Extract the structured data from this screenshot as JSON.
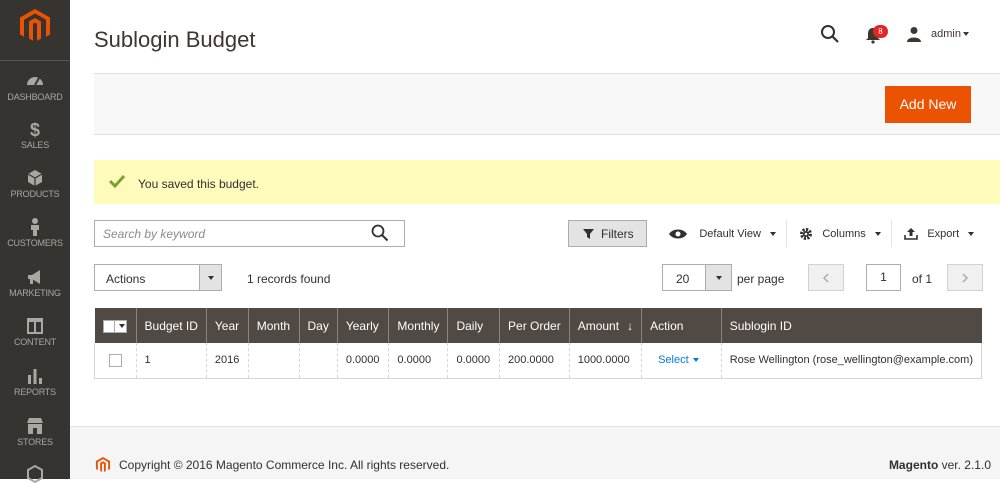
{
  "header": {
    "page_title": "Sublogin Budget",
    "notification_count": "8",
    "user_name": "admin"
  },
  "sidebar": {
    "items": [
      {
        "label": "Dashboard",
        "icon": "dashboard-icon"
      },
      {
        "label": "Sales",
        "icon": "dollar-icon"
      },
      {
        "label": "Products",
        "icon": "box-icon"
      },
      {
        "label": "Customers",
        "icon": "person-icon"
      },
      {
        "label": "Marketing",
        "icon": "megaphone-icon"
      },
      {
        "label": "Content",
        "icon": "layout-icon"
      },
      {
        "label": "Reports",
        "icon": "bar-chart-icon"
      },
      {
        "label": "Stores",
        "icon": "store-icon"
      }
    ]
  },
  "actions": {
    "add_new": "Add New"
  },
  "message": {
    "text": "You saved this budget."
  },
  "toolbar": {
    "search_placeholder": "Search by keyword",
    "filters": "Filters",
    "default_view": "Default View",
    "columns": "Columns",
    "export": "Export",
    "mass_actions": "Actions",
    "records_found": "1 records found",
    "per_page_value": "20",
    "per_page_label": "per page",
    "current_page": "1",
    "total_pages": "of 1"
  },
  "grid": {
    "columns": [
      "Budget ID",
      "Year",
      "Month",
      "Day",
      "Yearly",
      "Monthly",
      "Daily",
      "Per Order",
      "Amount",
      "Action",
      "Sublogin ID"
    ],
    "sort_indicator": "↓",
    "rows": [
      {
        "budget_id": "1",
        "year": "2016",
        "month": "",
        "day": "",
        "yearly": "0.0000",
        "monthly": "0.0000",
        "daily": "0.0000",
        "per_order": "200.0000",
        "amount": "1000.0000",
        "action": "Select",
        "sublogin_id": "Rose Wellington (rose_wellington@example.com)"
      }
    ]
  },
  "footer": {
    "copyright": "Copyright © 2016 Magento Commerce Inc. All rights reserved.",
    "brand": "Magento",
    "version": "ver. 2.1.0"
  },
  "colors": {
    "sidebar_bg": "#373330",
    "accent_orange": "#eb5202",
    "grid_header_bg": "#514943",
    "success_bg": "#fffbbb",
    "success_check": "#79a22e",
    "link": "#007bdb"
  }
}
